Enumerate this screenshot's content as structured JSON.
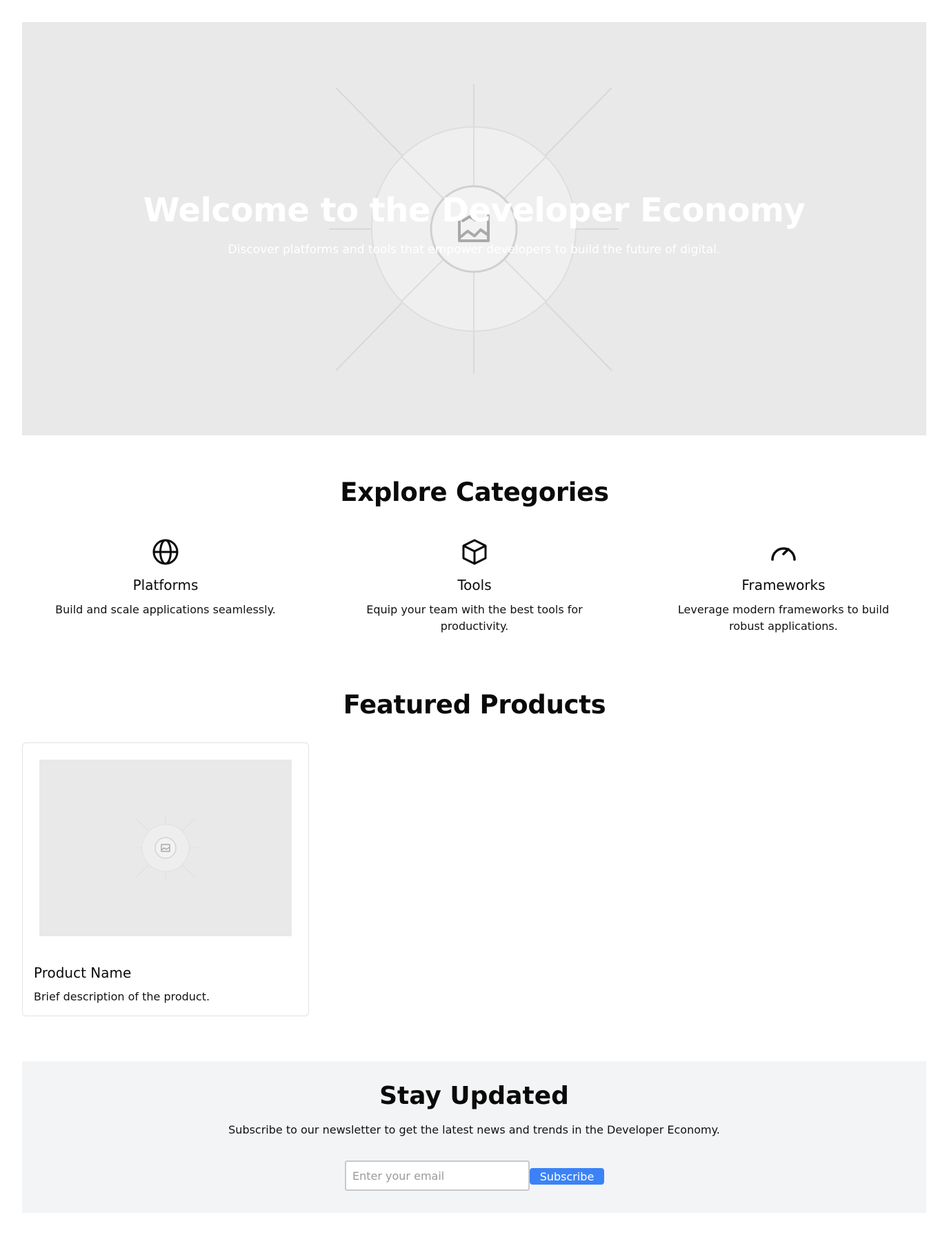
{
  "hero": {
    "title": "Welcome to the Developer Economy",
    "subtitle": "Discover platforms and tools that empower developers to build the future of digital.",
    "image_icon": "image-placeholder-icon"
  },
  "categories": {
    "title": "Explore Categories",
    "items": [
      {
        "icon": "globe-icon",
        "title": "Platforms",
        "description": "Build and scale applications seamlessly."
      },
      {
        "icon": "cube-icon",
        "title": "Tools",
        "description": "Equip your team with the best tools for productivity."
      },
      {
        "icon": "gauge-icon",
        "title": "Frameworks",
        "description": "Leverage modern frameworks to build robust applications."
      }
    ]
  },
  "featured": {
    "title": "Featured Products",
    "products": [
      {
        "image_icon": "image-placeholder-icon",
        "name": "Product Name",
        "description": "Brief description of the product."
      }
    ]
  },
  "newsletter": {
    "title": "Stay Updated",
    "description": "Subscribe to our newsletter to get the latest news and trends in the Developer Economy.",
    "email_placeholder": "Enter your email",
    "email_value": "",
    "button_label": "Subscribe"
  },
  "colors": {
    "accent": "#3b82f6",
    "placeholder_bg": "#e9e9e9",
    "newsletter_bg": "#f3f4f6"
  }
}
